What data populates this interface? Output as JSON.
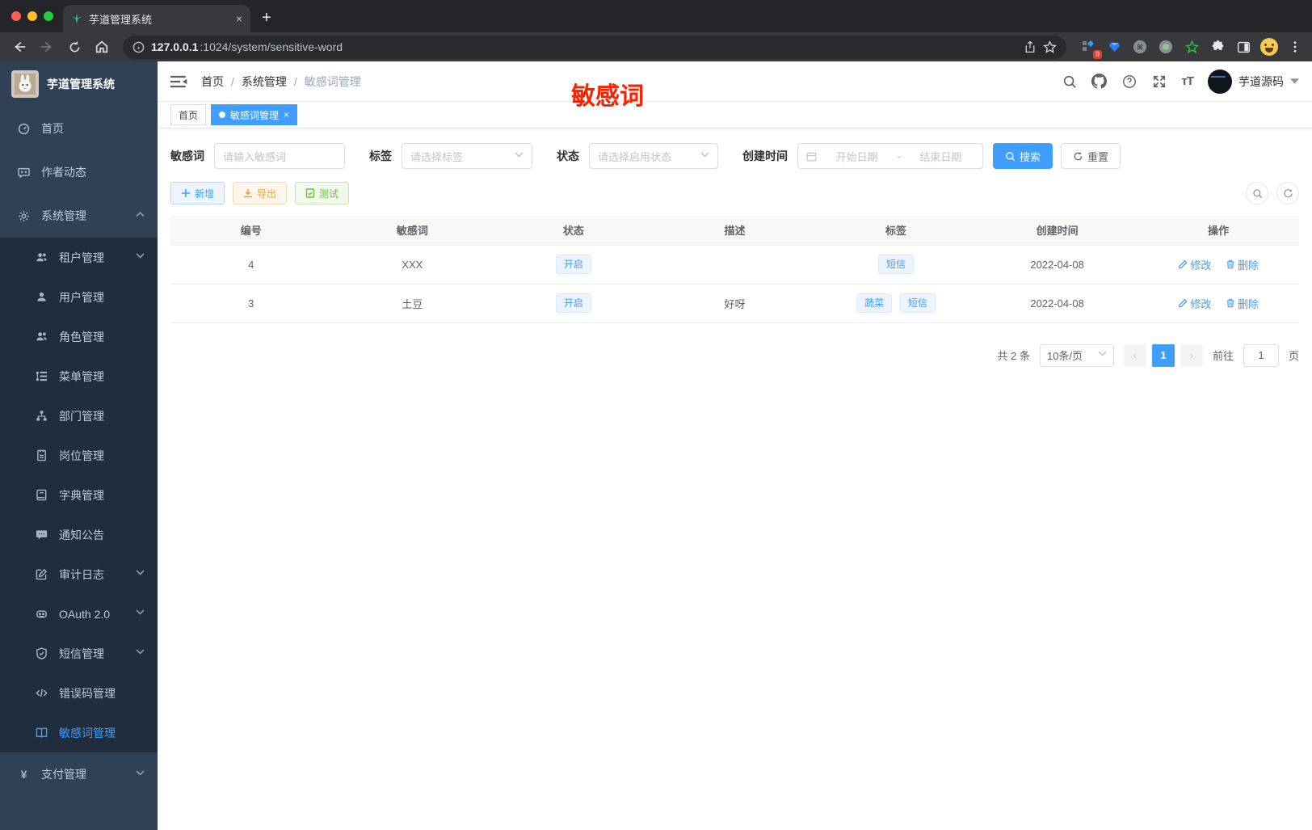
{
  "browser": {
    "tab_title": "芋道管理系统",
    "new_tab_label": "+",
    "close_label": "×",
    "url_host": "127.0.0.1",
    "url_rest": ":1024/system/sensitive-word",
    "extension_badge": "9"
  },
  "sidebar": {
    "title": "芋道管理系统",
    "items": [
      {
        "label": "首页"
      },
      {
        "label": "作者动态"
      },
      {
        "label": "系统管理"
      },
      {
        "label": "租户管理"
      },
      {
        "label": "用户管理"
      },
      {
        "label": "角色管理"
      },
      {
        "label": "菜单管理"
      },
      {
        "label": "部门管理"
      },
      {
        "label": "岗位管理"
      },
      {
        "label": "字典管理"
      },
      {
        "label": "通知公告"
      },
      {
        "label": "审计日志"
      },
      {
        "label": "OAuth 2.0"
      },
      {
        "label": "短信管理"
      },
      {
        "label": "错误码管理"
      },
      {
        "label": "敏感词管理"
      },
      {
        "label": "支付管理"
      }
    ]
  },
  "header": {
    "breadcrumb": [
      "首页",
      "系统管理",
      "敏感词管理"
    ],
    "separator": "/",
    "user_name": "芋道源码",
    "font_icon_text": "тT"
  },
  "annotation": {
    "text": "敏感词"
  },
  "tags_view": {
    "home": "首页",
    "active": "敏感词管理",
    "close": "×"
  },
  "filters": {
    "keyword_label": "敏感词",
    "keyword_placeholder": "请输入敏感词",
    "tag_label": "标签",
    "tag_placeholder": "请选择标签",
    "status_label": "状态",
    "status_placeholder": "请选择启用状态",
    "date_label": "创建时间",
    "date_start_placeholder": "开始日期",
    "date_separator": "-",
    "date_end_placeholder": "结束日期",
    "search_label": "搜索",
    "reset_label": "重置"
  },
  "toolbar": {
    "add_label": "新增",
    "export_label": "导出",
    "test_label": "测试"
  },
  "table": {
    "headers": [
      "编号",
      "敏感词",
      "状态",
      "描述",
      "标签",
      "创建时间",
      "操作"
    ],
    "rows": [
      {
        "id": "4",
        "word": "XXX",
        "status": "开启",
        "description": "",
        "tags": [
          "短信"
        ],
        "create_time": "2022-04-08",
        "edit": "修改",
        "delete": "删除"
      },
      {
        "id": "3",
        "word": "土豆",
        "status": "开启",
        "description": "好呀",
        "tags": [
          "蔬菜",
          "短信"
        ],
        "create_time": "2022-04-08",
        "edit": "修改",
        "delete": "删除"
      }
    ]
  },
  "pagination": {
    "total": "共 2 条",
    "page_size": "10条/页",
    "prev": "‹",
    "next": "›",
    "current_page": "1",
    "goto_label": "前往",
    "goto_value": "1",
    "goto_suffix": "页"
  },
  "colors": {
    "accent": "#409eff",
    "sidebar_bg": "#304156",
    "submenu_bg": "#1f2d3d",
    "warning": "#e6a23c",
    "success": "#67c23a",
    "annotation_red": "#ff2000"
  }
}
